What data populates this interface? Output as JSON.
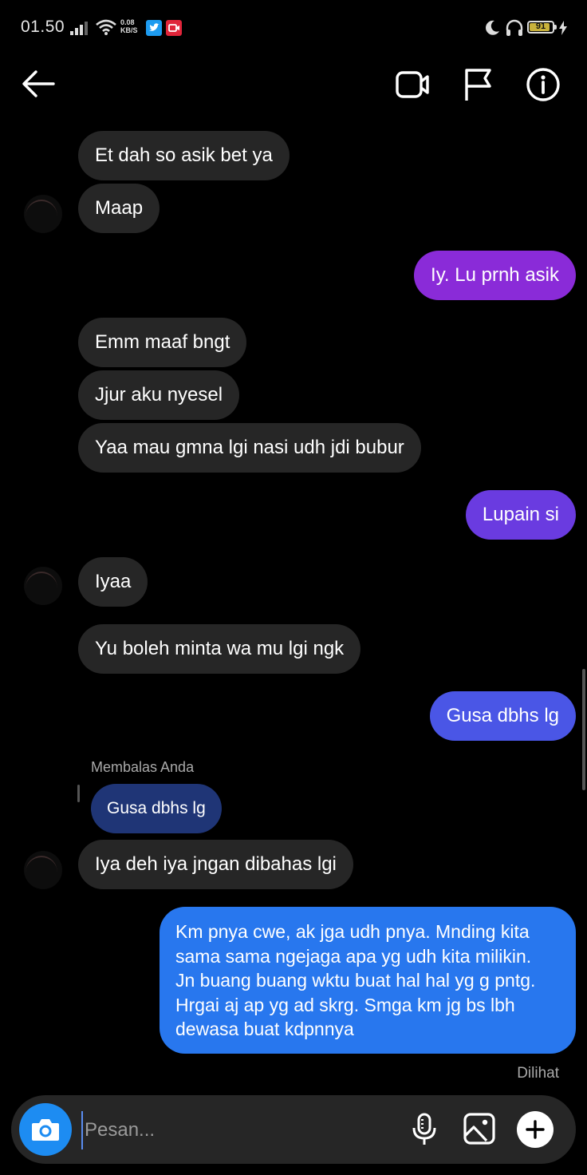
{
  "status_bar": {
    "time": "01.50",
    "net_speed_value": "0.08",
    "net_speed_unit": "KB/S",
    "battery": "91"
  },
  "header": {
    "back_icon": "arrow-left-icon",
    "video_icon": "video-camera-icon",
    "report_icon": "flag-icon",
    "info_icon": "info-icon"
  },
  "messages": [
    {
      "side": "in",
      "text": "Et dah so asik bet ya"
    },
    {
      "side": "in",
      "text": "Maap"
    },
    {
      "side": "out",
      "text": "Iy. Lu prnh asik",
      "color": "#8a2bd8"
    },
    {
      "side": "in",
      "text": "Emm maaf bngt"
    },
    {
      "side": "in",
      "text": "Jjur aku nyesel"
    },
    {
      "side": "in",
      "text": "Yaa mau gmna lgi nasi udh jdi bubur"
    },
    {
      "side": "out",
      "text": "Lupain si",
      "color": "#6a3be0"
    },
    {
      "side": "in",
      "text": "Iyaa"
    },
    {
      "side": "in",
      "text": "Yu boleh minta wa mu lgi ngk"
    },
    {
      "side": "out",
      "text": "Gusa dbhs lg",
      "color": "#4a56e6"
    },
    {
      "side": "in",
      "text": "Iya deh iya jngan dibahas lgi"
    },
    {
      "side": "out",
      "text": "Km pnya cwe, ak jga udh pnya. Mnding kita sama sama ngejaga apa yg udh kita milikin. Jn buang buang wktu buat hal hal yg g pntg. Hrgai aj ap yg ad skrg. Smga km jg bs lbh dewasa buat kdpnnya",
      "color": "#2877ee"
    }
  ],
  "long_message_lines": [
    "Km pnya cwe, ak jga udh pnya. Mnding kita",
    "sama sama ngejaga apa yg udh kita milikin.",
    "Jn buang buang wktu buat hal hal yg g pntg.",
    "Hrgai aj ap yg ad skrg. Smga km jg bs lbh",
    "dewasa buat kdpnnya"
  ],
  "reply": {
    "label": "Membalas Anda",
    "quoted": "Gusa dbhs lg"
  },
  "seen_status": "Dilihat",
  "composer": {
    "placeholder": "Pesan...",
    "camera_icon": "camera-icon",
    "mic_icon": "microphone-icon",
    "gallery_icon": "image-icon",
    "plus_icon": "plus-icon"
  }
}
